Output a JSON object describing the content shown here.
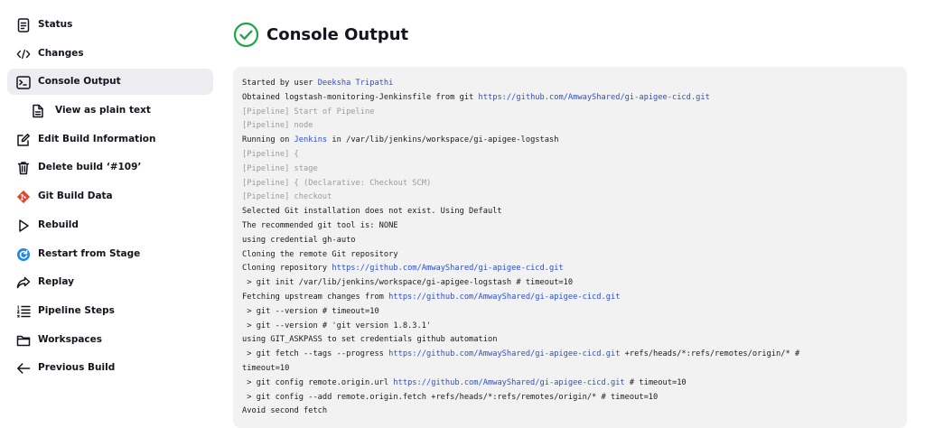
{
  "sidebar": {
    "items": [
      {
        "name": "status",
        "label": "Status",
        "icon": "document-icon"
      },
      {
        "name": "changes",
        "label": "Changes",
        "icon": "code-icon"
      },
      {
        "name": "console-output",
        "label": "Console Output",
        "icon": "terminal-icon",
        "active": true
      },
      {
        "name": "view-as-plain-text",
        "label": "View as plain text",
        "icon": "file-icon",
        "sub": true
      },
      {
        "name": "edit-build-information",
        "label": "Edit Build Information",
        "icon": "edit-icon"
      },
      {
        "name": "delete-build",
        "label": "Delete build ‘#109’",
        "icon": "trash-icon"
      },
      {
        "name": "git-build-data",
        "label": "Git Build Data",
        "icon": "git-icon"
      },
      {
        "name": "rebuild",
        "label": "Rebuild",
        "icon": "play-icon"
      },
      {
        "name": "restart-from-stage",
        "label": "Restart from Stage",
        "icon": "restart-icon"
      },
      {
        "name": "replay",
        "label": "Replay",
        "icon": "replay-arrow-icon"
      },
      {
        "name": "pipeline-steps",
        "label": "Pipeline Steps",
        "icon": "steps-list-icon"
      },
      {
        "name": "workspaces",
        "label": "Workspaces",
        "icon": "folder-icon"
      },
      {
        "name": "previous-build",
        "label": "Previous Build",
        "icon": "arrow-left-icon"
      }
    ]
  },
  "header": {
    "title": "Console Output",
    "status_icon": "success-check-icon",
    "status_color": "#1ea64b"
  },
  "colors": {
    "link": "#2c4fd1",
    "dim": "#9a9aa0",
    "console_bg": "#f2f2f3",
    "active_bg": "#ececf1"
  },
  "console": {
    "lines": [
      {
        "parts": [
          {
            "t": "Started by user "
          },
          {
            "t": "Deeksha Tripathi",
            "link": true
          }
        ]
      },
      {
        "parts": [
          {
            "t": "Obtained logstash-monitoring-Jenkinsfile from git "
          },
          {
            "t": "https://github.com/AmwayShared/gi-apigee-cicd.git",
            "link": true
          }
        ]
      },
      {
        "dim": true,
        "parts": [
          {
            "t": "[Pipeline] Start of Pipeline"
          }
        ]
      },
      {
        "dim": true,
        "parts": [
          {
            "t": "[Pipeline] node"
          }
        ]
      },
      {
        "parts": [
          {
            "t": "Running on "
          },
          {
            "t": "Jenkins",
            "link": true
          },
          {
            "t": " in /var/lib/jenkins/workspace/gi-apigee-logstash"
          }
        ]
      },
      {
        "dim": true,
        "parts": [
          {
            "t": "[Pipeline] {"
          }
        ]
      },
      {
        "dim": true,
        "parts": [
          {
            "t": "[Pipeline] stage"
          }
        ]
      },
      {
        "dim": true,
        "parts": [
          {
            "t": "[Pipeline] { (Declarative: Checkout SCM)"
          }
        ]
      },
      {
        "dim": true,
        "parts": [
          {
            "t": "[Pipeline] checkout"
          }
        ]
      },
      {
        "parts": [
          {
            "t": "Selected Git installation does not exist. Using Default"
          }
        ]
      },
      {
        "parts": [
          {
            "t": "The recommended git tool is: NONE"
          }
        ]
      },
      {
        "parts": [
          {
            "t": "using credential gh-auto"
          }
        ]
      },
      {
        "parts": [
          {
            "t": "Cloning the remote Git repository"
          }
        ]
      },
      {
        "parts": [
          {
            "t": "Cloning repository "
          },
          {
            "t": "https://github.com/AmwayShared/gi-apigee-cicd.git",
            "link": true
          }
        ]
      },
      {
        "parts": [
          {
            "t": " > git init /var/lib/jenkins/workspace/gi-apigee-logstash # timeout=10"
          }
        ]
      },
      {
        "parts": [
          {
            "t": "Fetching upstream changes from "
          },
          {
            "t": "https://github.com/AmwayShared/gi-apigee-cicd.git",
            "link": true
          }
        ]
      },
      {
        "parts": [
          {
            "t": " > git --version # timeout=10"
          }
        ]
      },
      {
        "parts": [
          {
            "t": " > git --version # 'git version 1.8.3.1'"
          }
        ]
      },
      {
        "parts": [
          {
            "t": "using GIT_ASKPASS to set credentials github automation"
          }
        ]
      },
      {
        "parts": [
          {
            "t": " > git fetch --tags --progress "
          },
          {
            "t": "https://github.com/AmwayShared/gi-apigee-cicd.git",
            "link": true
          },
          {
            "t": " +refs/heads/*:refs/remotes/origin/* #"
          }
        ]
      },
      {
        "parts": [
          {
            "t": "timeout=10"
          }
        ]
      },
      {
        "parts": [
          {
            "t": " > git config remote.origin.url "
          },
          {
            "t": "https://github.com/AmwayShared/gi-apigee-cicd.git",
            "link": true
          },
          {
            "t": " # timeout=10"
          }
        ]
      },
      {
        "parts": [
          {
            "t": " > git config --add remote.origin.fetch +refs/heads/*:refs/remotes/origin/* # timeout=10"
          }
        ]
      },
      {
        "parts": [
          {
            "t": "Avoid second fetch"
          }
        ]
      }
    ]
  }
}
